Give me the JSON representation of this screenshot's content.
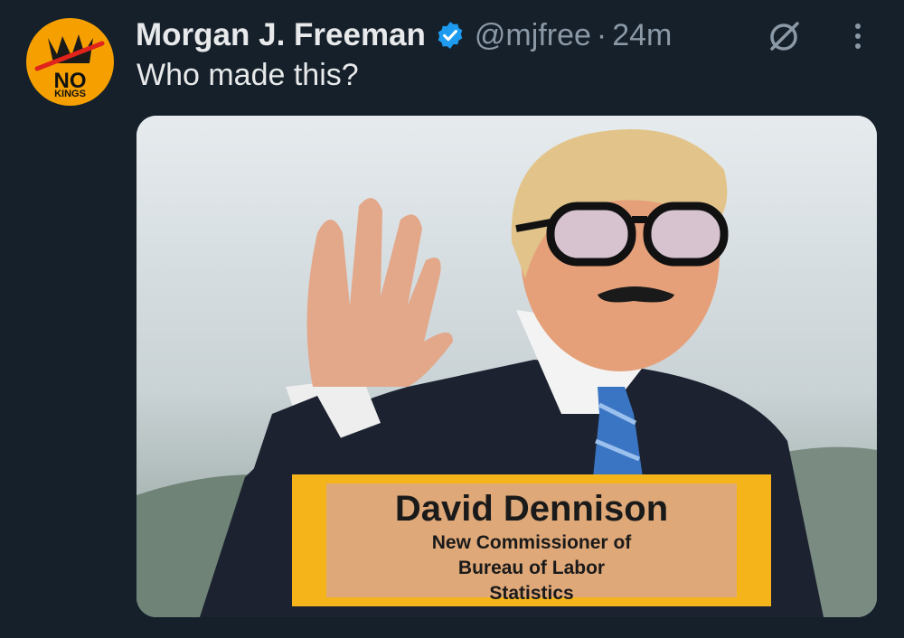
{
  "tweet": {
    "author_name": "Morgan J. Freeman",
    "handle": "@mjfree",
    "separator": "·",
    "time": "24m",
    "text": "Who made this?"
  },
  "avatar": {
    "line1": "NO",
    "line2": "KINGS",
    "color": "#f5a000"
  },
  "media": {
    "caption_name": "David Dennison",
    "caption_lines": [
      "New Commissioner of",
      "Bureau of Labor",
      "Statistics"
    ]
  },
  "icons": {
    "verified": "verified-badge-icon",
    "grok": "grok-icon",
    "more": "more-vertical-icon"
  },
  "colors": {
    "background": "#15202b",
    "verified": "#1d9bf0",
    "muted": "#8b98a5",
    "caption_frame": "#f4b41a"
  }
}
